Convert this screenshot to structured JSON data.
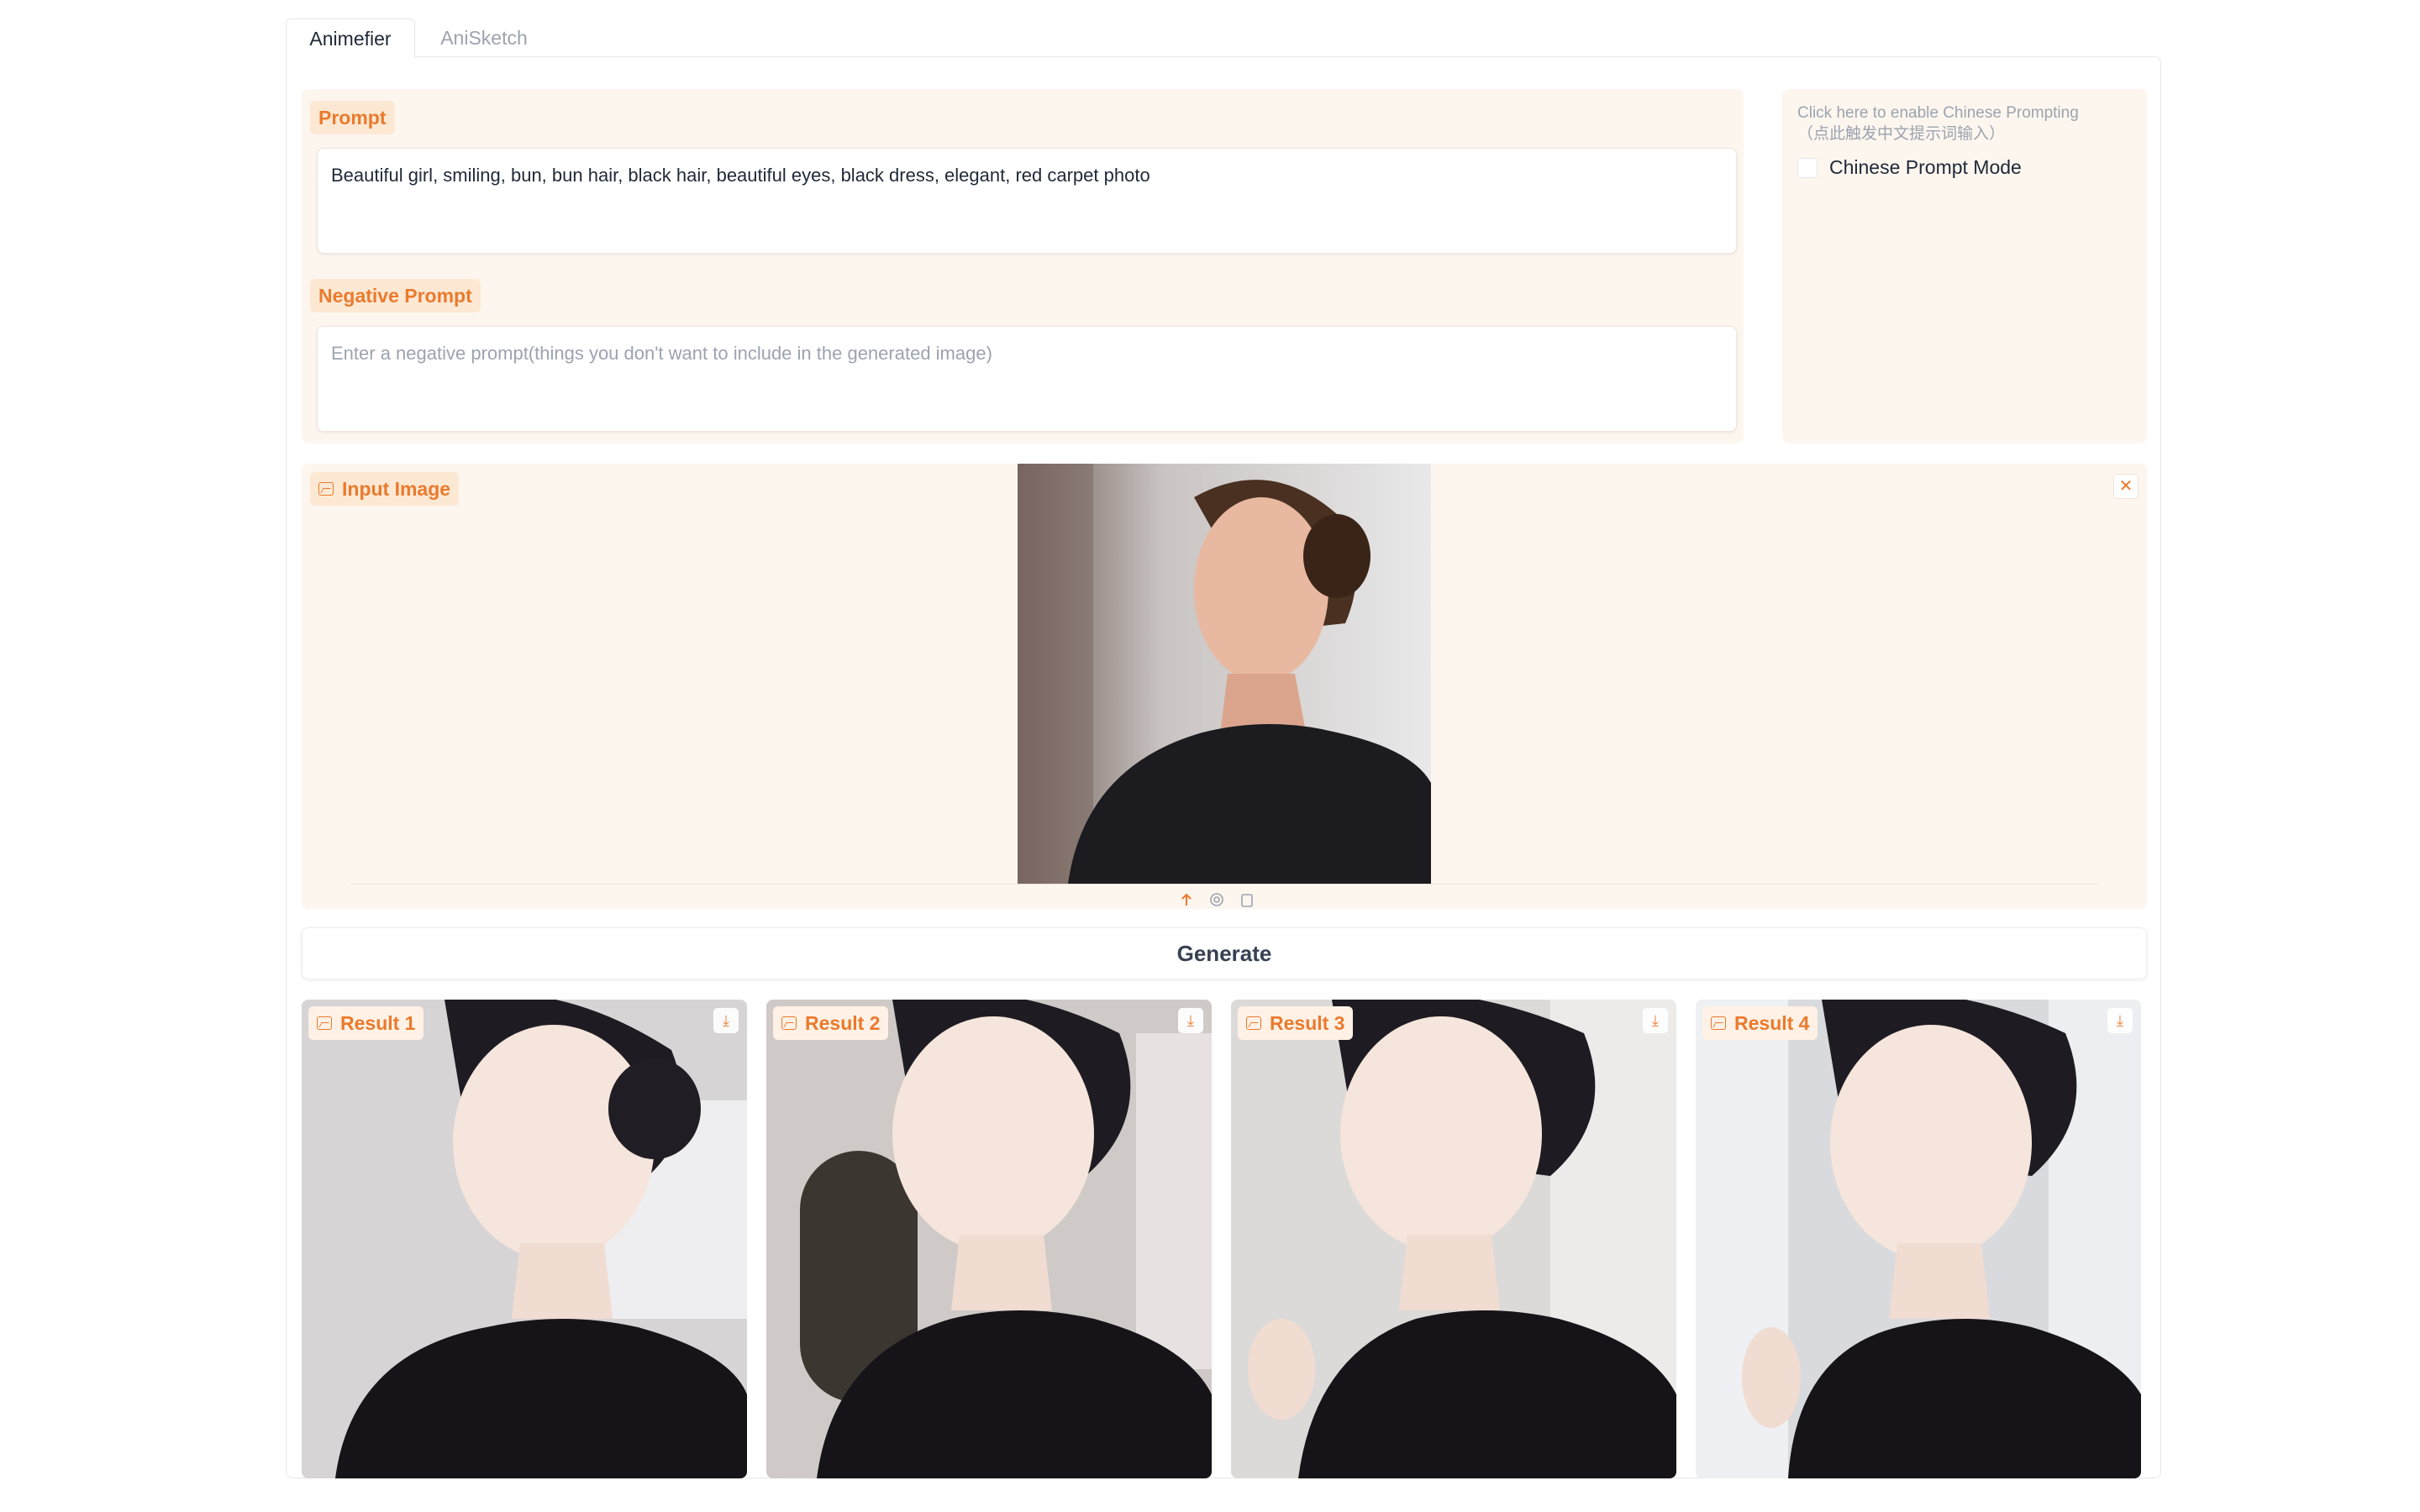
{
  "tabs": [
    {
      "label": "Animefier",
      "active": true
    },
    {
      "label": "AniSketch",
      "active": false
    }
  ],
  "prompt": {
    "label": "Prompt",
    "value": "Beautiful girl, smiling, bun, bun hair, black hair, beautiful eyes, black dress, elegant, red carpet photo"
  },
  "negative_prompt": {
    "label": "Negative Prompt",
    "placeholder": "Enter a negative prompt(things you don't want to include in the generated image)"
  },
  "chinese": {
    "hint_line1": "Click here to enable Chinese Prompting",
    "hint_line2": "（点此触发中文提示词输入）",
    "checkbox_label": "Chinese Prompt Mode",
    "checked": false
  },
  "input_image": {
    "label": "Input Image",
    "close_symbol": "✕"
  },
  "generate_label": "Generate",
  "results": [
    {
      "label": "Result 1"
    },
    {
      "label": "Result 2"
    },
    {
      "label": "Result 3"
    },
    {
      "label": "Result 4"
    }
  ],
  "colors": {
    "accent": "#ea7a2c",
    "panel_bg": "#fdf6ef",
    "label_bg": "#fde8d4"
  },
  "icons": [
    "image-icon",
    "close-icon",
    "download-icon",
    "upload-icon",
    "webcam-icon",
    "clipboard-icon"
  ]
}
